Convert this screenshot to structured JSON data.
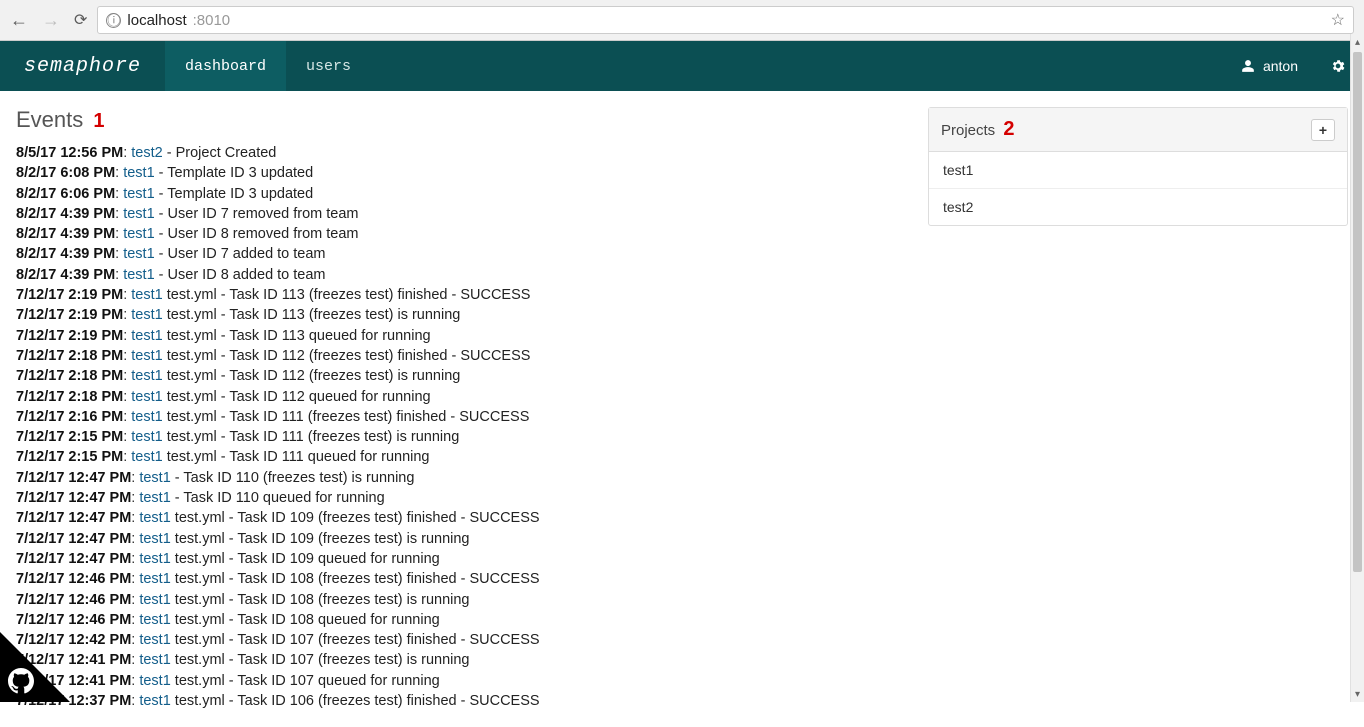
{
  "browser": {
    "url_host": "localhost",
    "url_port": ":8010"
  },
  "header": {
    "brand": "semaphore",
    "nav": [
      {
        "label": "dashboard",
        "active": true
      },
      {
        "label": "users",
        "active": false
      }
    ],
    "username": "anton"
  },
  "annotations": {
    "events": "1",
    "projects": "2"
  },
  "events_title": "Events",
  "events": [
    {
      "ts": "8/5/17 12:56 PM",
      "project": "test2",
      "desc": " - Project Created"
    },
    {
      "ts": "8/2/17 6:08 PM",
      "project": "test1",
      "desc": " - Template ID 3 updated"
    },
    {
      "ts": "8/2/17 6:06 PM",
      "project": "test1",
      "desc": " - Template ID 3 updated"
    },
    {
      "ts": "8/2/17 4:39 PM",
      "project": "test1",
      "desc": " - User ID 7 removed from team"
    },
    {
      "ts": "8/2/17 4:39 PM",
      "project": "test1",
      "desc": " - User ID 8 removed from team"
    },
    {
      "ts": "8/2/17 4:39 PM",
      "project": "test1",
      "desc": " - User ID 7 added to team"
    },
    {
      "ts": "8/2/17 4:39 PM",
      "project": "test1",
      "desc": " - User ID 8 added to team"
    },
    {
      "ts": "7/12/17 2:19 PM",
      "project": "test1",
      "desc": "test.yml - Task ID 113 (freezes test) finished - SUCCESS"
    },
    {
      "ts": "7/12/17 2:19 PM",
      "project": "test1",
      "desc": "test.yml - Task ID 113 (freezes test) is running"
    },
    {
      "ts": "7/12/17 2:19 PM",
      "project": "test1",
      "desc": "test.yml - Task ID 113 queued for running"
    },
    {
      "ts": "7/12/17 2:18 PM",
      "project": "test1",
      "desc": "test.yml - Task ID 112 (freezes test) finished - SUCCESS"
    },
    {
      "ts": "7/12/17 2:18 PM",
      "project": "test1",
      "desc": "test.yml - Task ID 112 (freezes test) is running"
    },
    {
      "ts": "7/12/17 2:18 PM",
      "project": "test1",
      "desc": "test.yml - Task ID 112 queued for running"
    },
    {
      "ts": "7/12/17 2:16 PM",
      "project": "test1",
      "desc": "test.yml - Task ID 111 (freezes test) finished - SUCCESS"
    },
    {
      "ts": "7/12/17 2:15 PM",
      "project": "test1",
      "desc": "test.yml - Task ID 111 (freezes test) is running"
    },
    {
      "ts": "7/12/17 2:15 PM",
      "project": "test1",
      "desc": "test.yml - Task ID 111 queued for running"
    },
    {
      "ts": "7/12/17 12:47 PM",
      "project": "test1",
      "desc": " - Task ID 110 (freezes test) is running"
    },
    {
      "ts": "7/12/17 12:47 PM",
      "project": "test1",
      "desc": " - Task ID 110 queued for running"
    },
    {
      "ts": "7/12/17 12:47 PM",
      "project": "test1",
      "desc": "test.yml - Task ID 109 (freezes test) finished - SUCCESS"
    },
    {
      "ts": "7/12/17 12:47 PM",
      "project": "test1",
      "desc": "test.yml - Task ID 109 (freezes test) is running"
    },
    {
      "ts": "7/12/17 12:47 PM",
      "project": "test1",
      "desc": "test.yml - Task ID 109 queued for running"
    },
    {
      "ts": "7/12/17 12:46 PM",
      "project": "test1",
      "desc": "test.yml - Task ID 108 (freezes test) finished - SUCCESS"
    },
    {
      "ts": "7/12/17 12:46 PM",
      "project": "test1",
      "desc": "test.yml - Task ID 108 (freezes test) is running"
    },
    {
      "ts": "7/12/17 12:46 PM",
      "project": "test1",
      "desc": "test.yml - Task ID 108 queued for running"
    },
    {
      "ts": "7/12/17 12:42 PM",
      "project": "test1",
      "desc": "test.yml - Task ID 107 (freezes test) finished - SUCCESS"
    },
    {
      "ts": "7/12/17 12:41 PM",
      "project": "test1",
      "desc": "test.yml - Task ID 107 (freezes test) is running"
    },
    {
      "ts": "7/12/17 12:41 PM",
      "project": "test1",
      "desc": "test.yml - Task ID 107 queued for running"
    },
    {
      "ts": "7/12/17 12:37 PM",
      "project": "test1",
      "desc": "test.yml - Task ID 106 (freezes test) finished - SUCCESS"
    }
  ],
  "sidebar": {
    "projects_title": "Projects",
    "add_label": "+",
    "projects": [
      {
        "name": "test1"
      },
      {
        "name": "test2"
      }
    ]
  }
}
